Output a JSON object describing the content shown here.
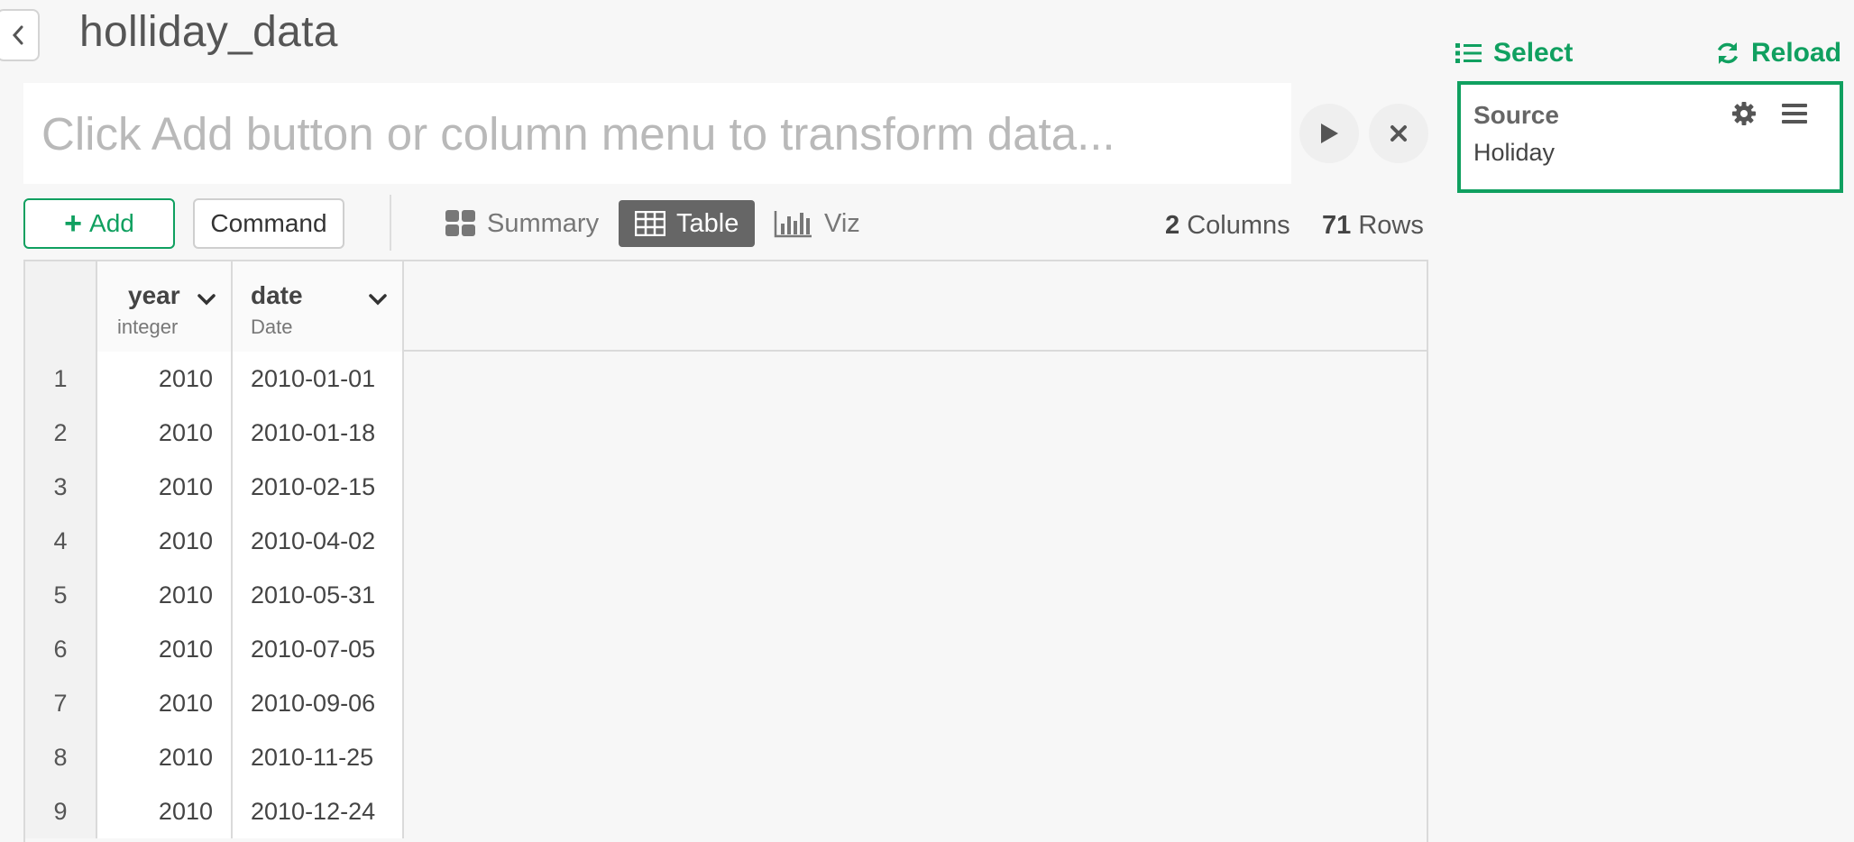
{
  "header": {
    "title": "holliday_data",
    "back_icon": "chevron-left-icon"
  },
  "command": {
    "placeholder": "Click Add button or column menu to transform data...",
    "value": "",
    "run_icon": "play-icon",
    "clear_icon": "close-icon"
  },
  "toolbar": {
    "add_label": "Add",
    "command_label": "Command",
    "tabs": [
      {
        "label": "Summary",
        "icon": "summary-grid-icon",
        "active": false
      },
      {
        "label": "Table",
        "icon": "table-icon",
        "active": true
      },
      {
        "label": "Viz",
        "icon": "bar-chart-icon",
        "active": false
      }
    ],
    "columns_count": "2",
    "columns_label": "Columns",
    "rows_count": "71",
    "rows_label": "Rows"
  },
  "table": {
    "columns": [
      {
        "name": "year",
        "type": "integer"
      },
      {
        "name": "date",
        "type": "Date"
      }
    ],
    "rows": [
      {
        "n": "1",
        "year": "2010",
        "date": "2010-01-01"
      },
      {
        "n": "2",
        "year": "2010",
        "date": "2010-01-18"
      },
      {
        "n": "3",
        "year": "2010",
        "date": "2010-02-15"
      },
      {
        "n": "4",
        "year": "2010",
        "date": "2010-04-02"
      },
      {
        "n": "5",
        "year": "2010",
        "date": "2010-05-31"
      },
      {
        "n": "6",
        "year": "2010",
        "date": "2010-07-05"
      },
      {
        "n": "7",
        "year": "2010",
        "date": "2010-09-06"
      },
      {
        "n": "8",
        "year": "2010",
        "date": "2010-11-25"
      },
      {
        "n": "9",
        "year": "2010",
        "date": "2010-12-24"
      }
    ]
  },
  "sidebar": {
    "select_label": "Select",
    "reload_label": "Reload",
    "step": {
      "title": "Source",
      "subtitle": "Holiday"
    }
  },
  "colors": {
    "accent": "#10a060",
    "active_tab": "#666666"
  }
}
